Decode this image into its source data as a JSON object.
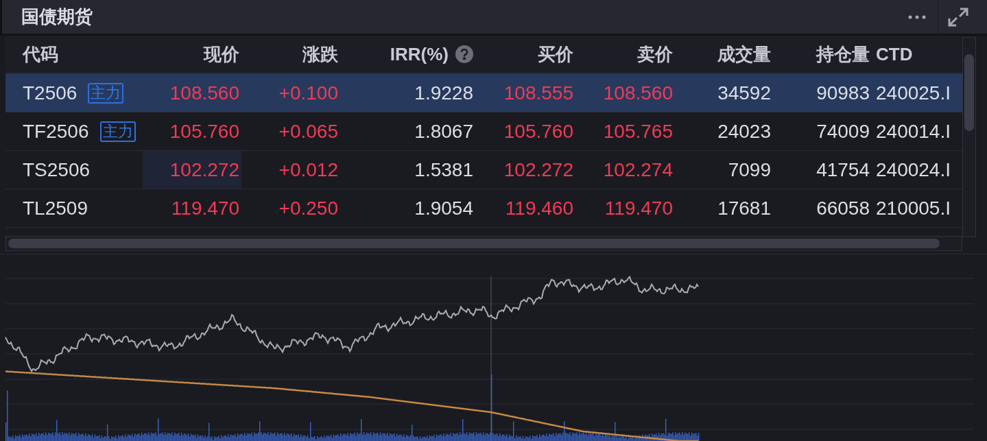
{
  "panel": {
    "title": "国债期货"
  },
  "table": {
    "columns": [
      {
        "label": "代码",
        "help": false
      },
      {
        "label": "现价",
        "help": false
      },
      {
        "label": "涨跌",
        "help": false
      },
      {
        "label": "IRR(%)",
        "help": true
      },
      {
        "label": "买价",
        "help": false
      },
      {
        "label": "卖价",
        "help": false
      },
      {
        "label": "成交量",
        "help": false
      },
      {
        "label": "持仓量",
        "help": false
      },
      {
        "label": "CTD",
        "help": false
      }
    ],
    "rows": [
      {
        "code": "T2506",
        "tag": "主力",
        "price": "108.560",
        "change": "+0.100",
        "irr": "1.9228",
        "bid": "108.555",
        "ask": "108.560",
        "volume": "34592",
        "open_interest": "90983",
        "ctd": "240025.I",
        "selected": true,
        "price_highlighted": false
      },
      {
        "code": "TF2506",
        "tag": "主力",
        "price": "105.760",
        "change": "+0.065",
        "irr": "1.8067",
        "bid": "105.760",
        "ask": "105.765",
        "volume": "24023",
        "open_interest": "74009",
        "ctd": "240014.I",
        "selected": false,
        "price_highlighted": false
      },
      {
        "code": "TS2506",
        "price": "102.272",
        "change": "+0.012",
        "irr": "1.5381",
        "bid": "102.272",
        "ask": "102.274",
        "volume": "7099",
        "open_interest": "41754",
        "ctd": "240024.I",
        "selected": false,
        "price_highlighted": true
      },
      {
        "code": "TL2509",
        "price": "119.470",
        "change": "+0.250",
        "irr": "1.9054",
        "bid": "119.460",
        "ask": "119.470",
        "volume": "17681",
        "open_interest": "66058",
        "ctd": "210005.I",
        "selected": false,
        "price_highlighted": false
      }
    ]
  }
}
